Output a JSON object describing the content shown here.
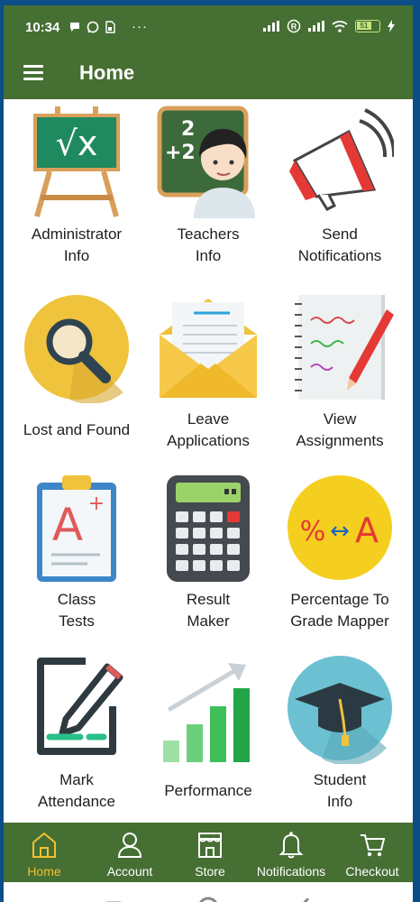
{
  "status_bar": {
    "time": "10:34",
    "more": "···",
    "battery": "51",
    "left_icons": [
      "message-bubble-icon",
      "whatsapp-icon",
      "sim-icon"
    ],
    "right_icons": [
      "signal-icon",
      "registered-icon",
      "signal-icon",
      "wifi-icon",
      "battery-icon",
      "charging-icon"
    ]
  },
  "app_bar": {
    "title": "Home",
    "menu_icon": "hamburger-menu-icon"
  },
  "tiles": [
    {
      "label": "Administrator\nInfo",
      "icon": "chalkboard-sqrt-x-icon"
    },
    {
      "label": "Teachers\nInfo",
      "icon": "teacher-icon"
    },
    {
      "label": "Send\nNotifications",
      "icon": "megaphone-icon"
    },
    {
      "label": "Lost and Found",
      "icon": "magnifier-icon"
    },
    {
      "label": "Leave\nApplications",
      "icon": "envelope-letter-icon"
    },
    {
      "label": "View\nAssignments",
      "icon": "notebook-pencil-icon"
    },
    {
      "label": "Class\nTests",
      "icon": "clipboard-grade-icon"
    },
    {
      "label": "Result\nMaker",
      "icon": "calculator-icon"
    },
    {
      "label": "Percentage To\nGrade Mapper",
      "icon": "percent-to-grade-icon"
    },
    {
      "label": "Mark\nAttendance",
      "icon": "pen-paper-icon"
    },
    {
      "label": "Performance",
      "icon": "growth-chart-icon"
    },
    {
      "label": "Student\nInfo",
      "icon": "graduation-cap-icon"
    }
  ],
  "icon_text": {
    "chalkboard": "√x",
    "teacher_board_top": "2",
    "teacher_board_bottom": "+2",
    "percent_grade_left": "%",
    "percent_grade_arrow": "↔",
    "percent_grade_right": "A",
    "clipboard_grade": "A",
    "clipboard_plus": "+"
  },
  "bottom_nav": [
    {
      "label": "Home",
      "icon": "home-icon",
      "active": true
    },
    {
      "label": "Account",
      "icon": "account-icon",
      "active": false
    },
    {
      "label": "Store",
      "icon": "store-icon",
      "active": false
    },
    {
      "label": "Notifications",
      "icon": "bell-icon",
      "active": false
    },
    {
      "label": "Checkout",
      "icon": "cart-icon",
      "active": false
    }
  ],
  "colors": {
    "primary": "#466f34",
    "active_nav": "#f2c12e",
    "nav_text": "#ffffff"
  }
}
